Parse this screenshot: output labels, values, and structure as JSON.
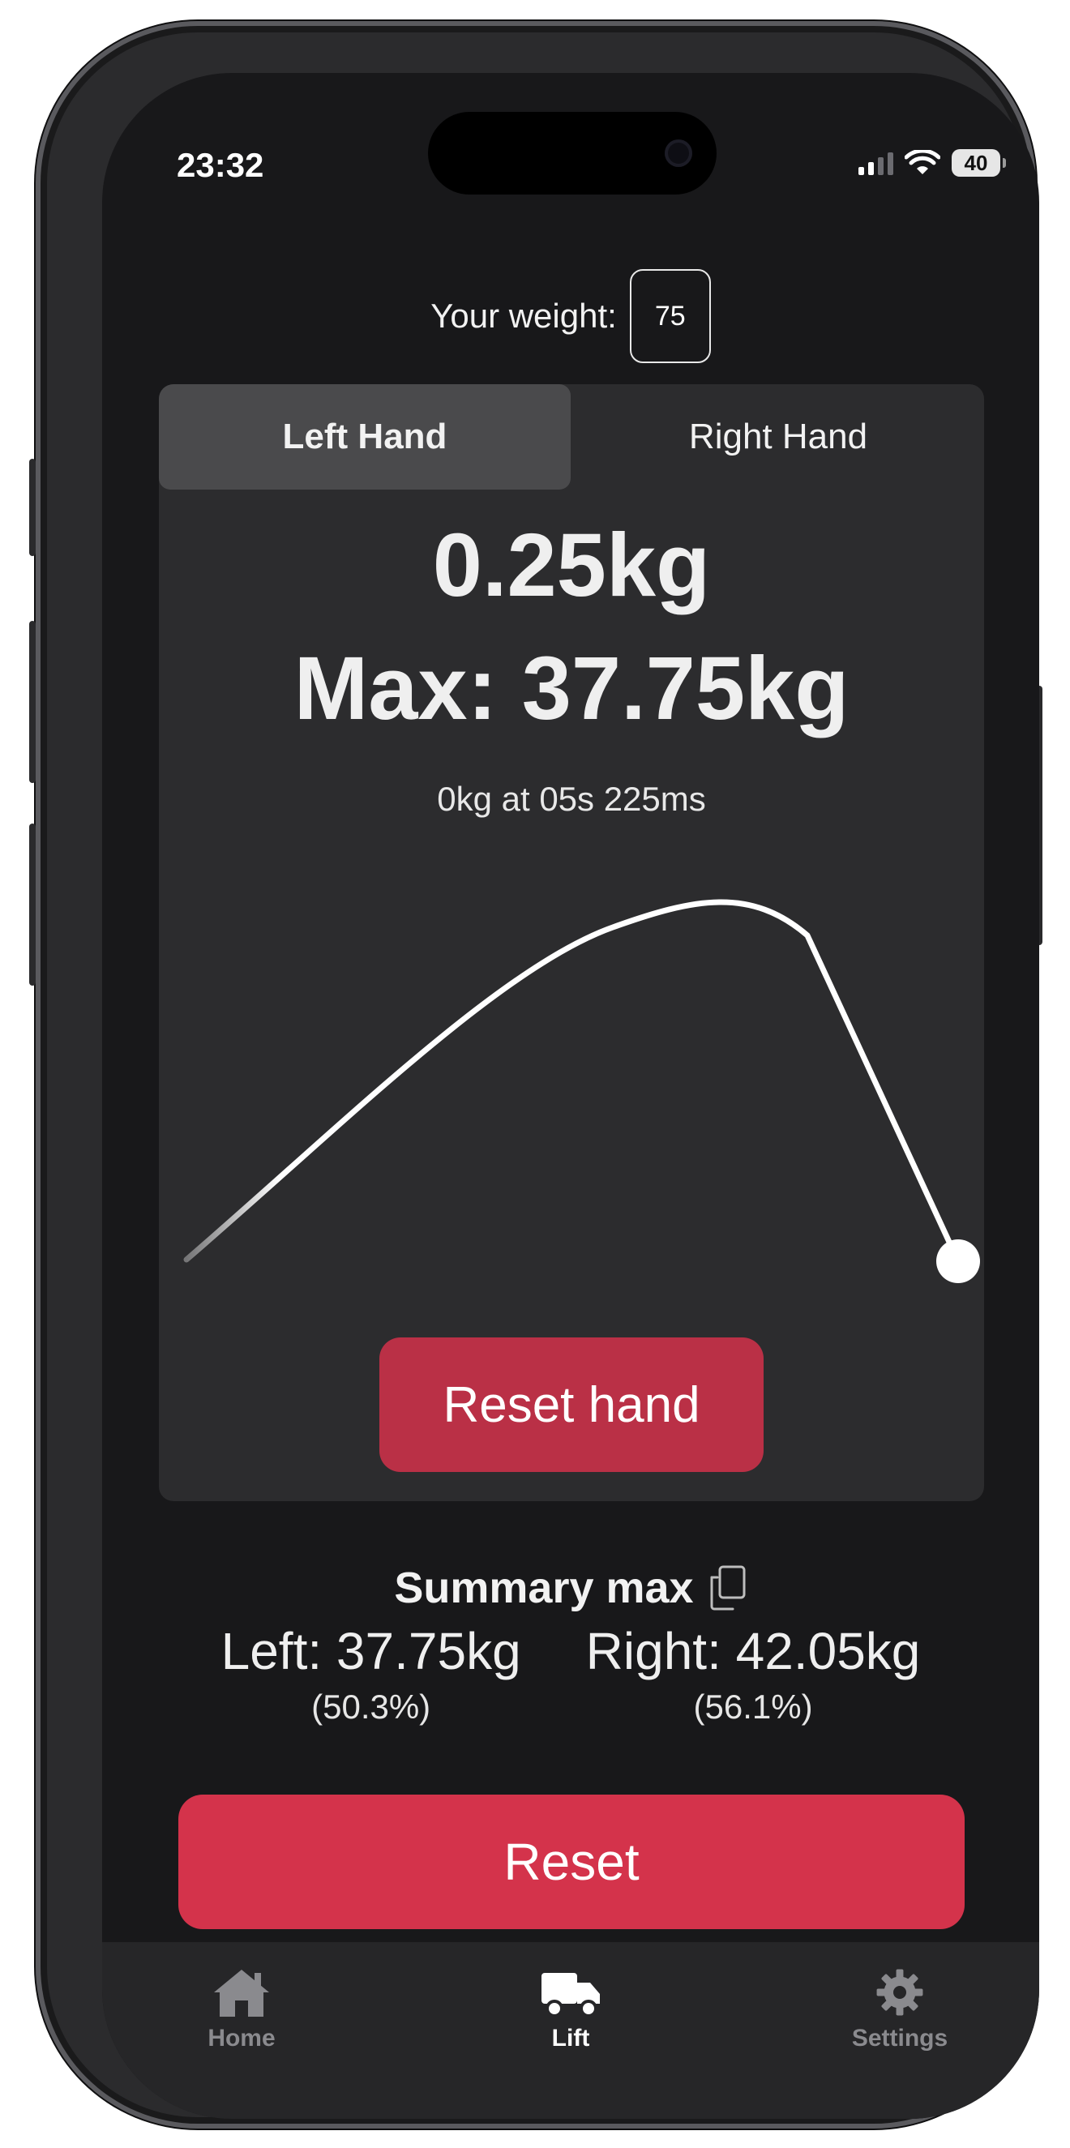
{
  "status": {
    "time": "23:32",
    "battery": "40"
  },
  "weight": {
    "label": "Your weight:",
    "value": "75"
  },
  "tabs": {
    "left": "Left Hand",
    "right": "Right Hand"
  },
  "reading": {
    "current": "0.25kg",
    "max": "Max: 37.75kg",
    "at": "0kg at 05s 225ms"
  },
  "buttons": {
    "reset_hand": "Reset hand",
    "reset": "Reset"
  },
  "summary": {
    "title": "Summary max",
    "left_value": "Left: 37.75kg",
    "left_pct": "(50.3%)",
    "right_value": "Right: 42.05kg",
    "right_pct": "(56.1%)"
  },
  "nav": {
    "home": "Home",
    "lift": "Lift",
    "settings": "Settings"
  },
  "colors": {
    "background": "#18181a",
    "card": "#2c2c2e",
    "accent": "#d4334b",
    "accent_dark": "#ba3046"
  }
}
